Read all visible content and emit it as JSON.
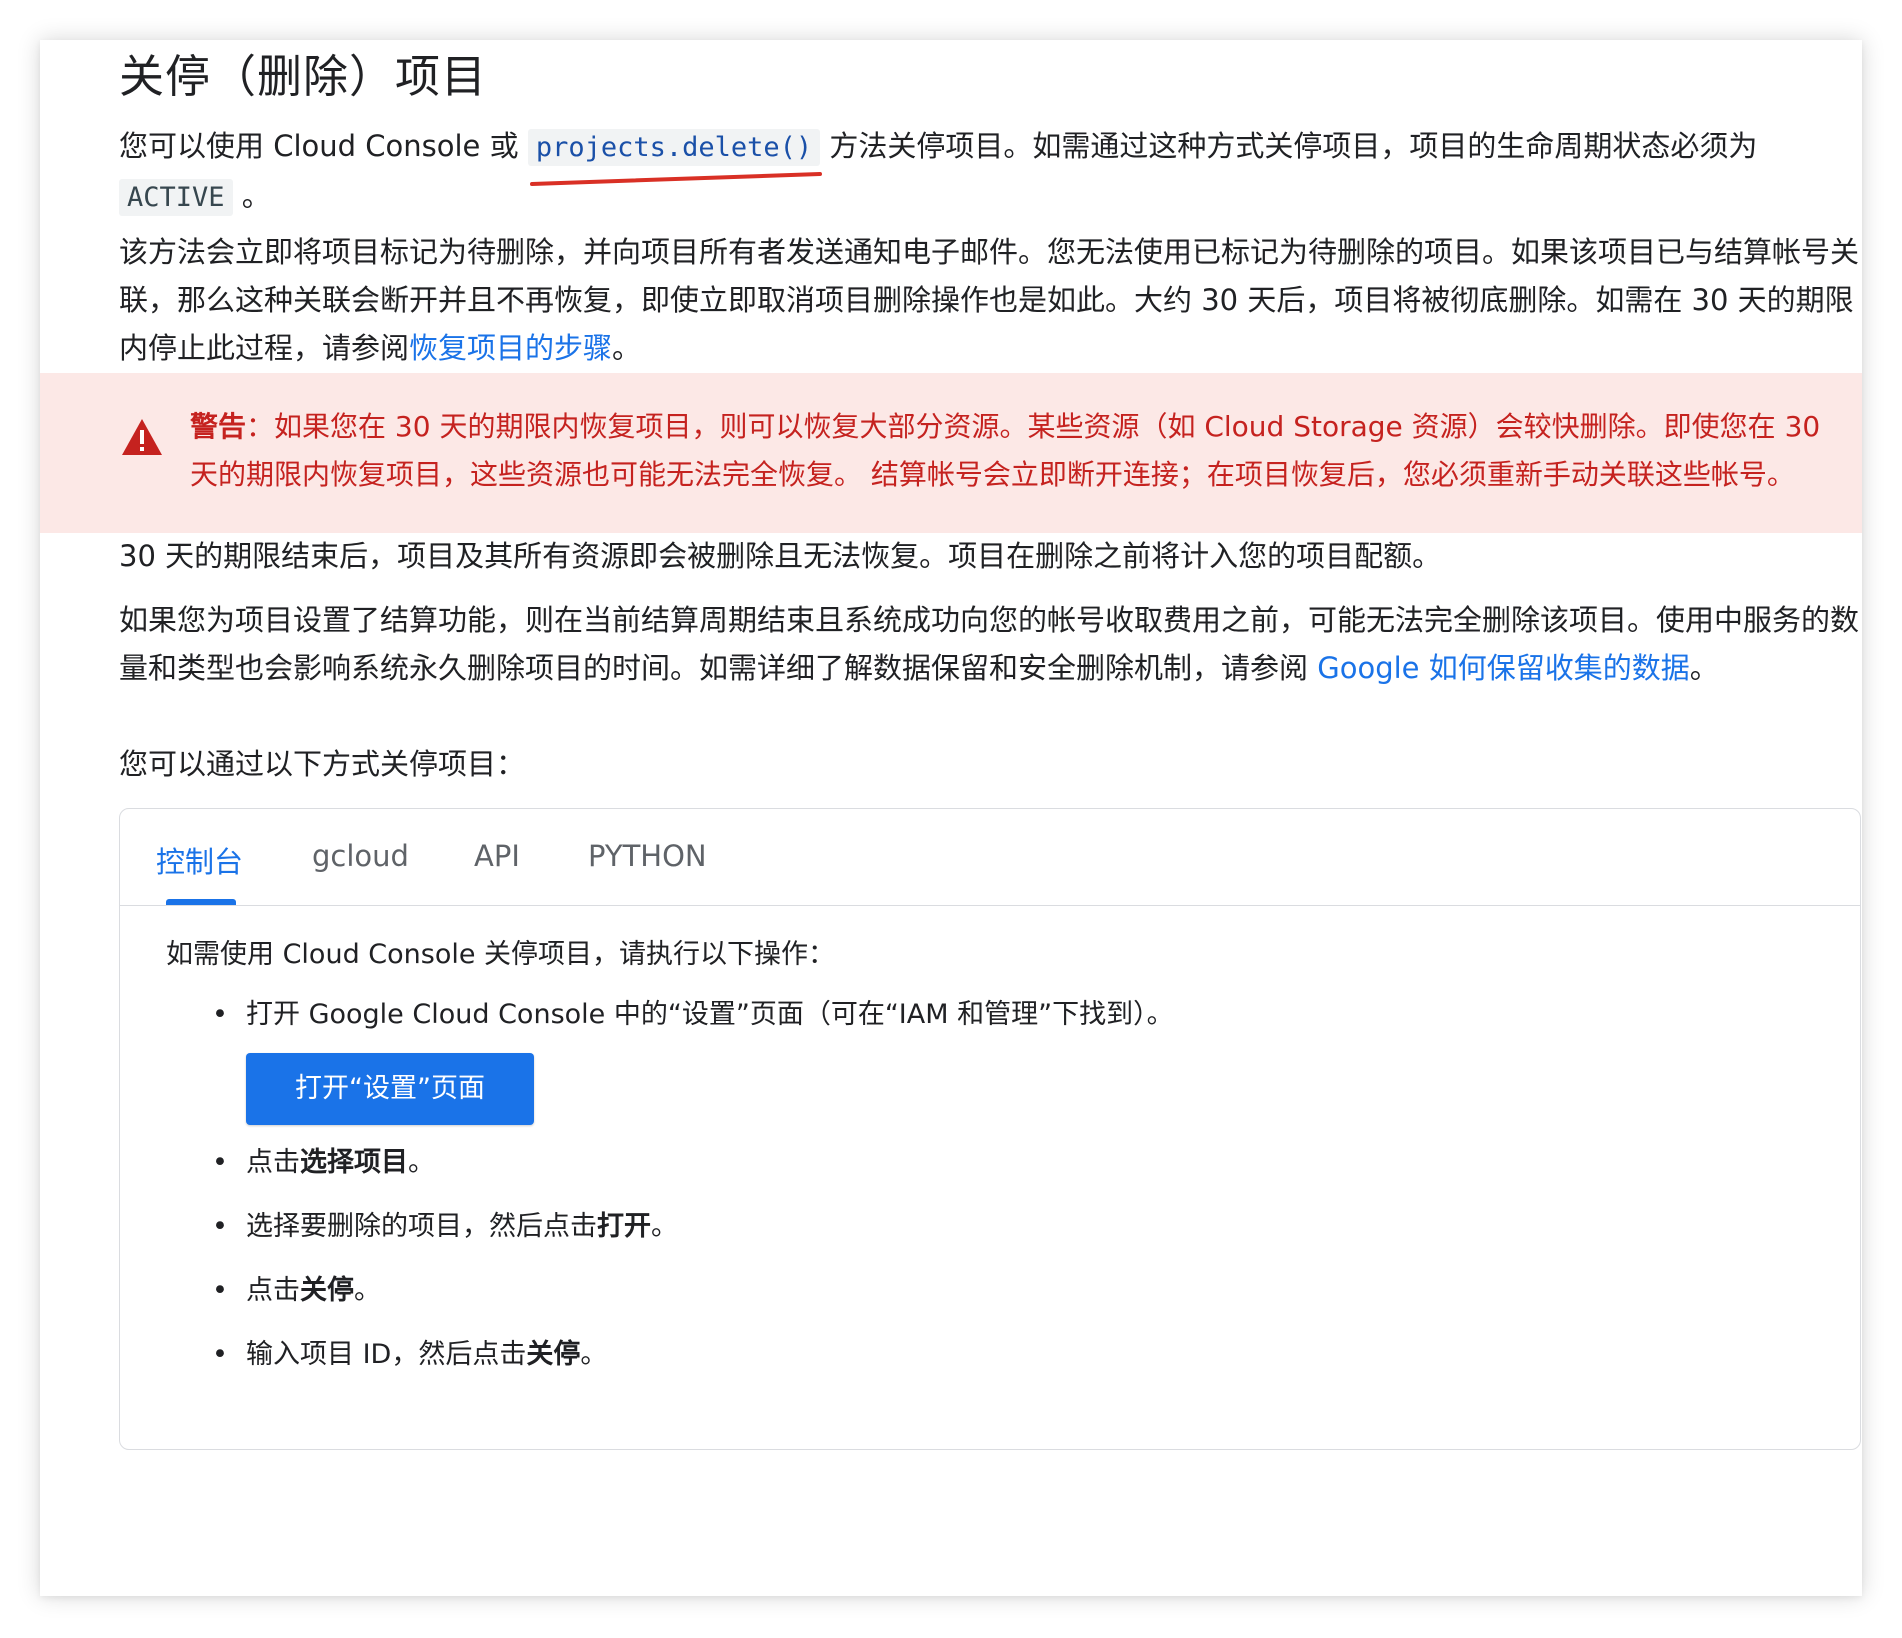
{
  "page": {
    "title": "关停（删除）项目"
  },
  "intro": {
    "part1": "您可以使用 Cloud Console 或 ",
    "code_link": "projects.delete()",
    "part2": " 方法关停项目。如需通过这种方式关停项目，项目的生命周期状态必须为 ",
    "state_code": "ACTIVE",
    "part3": " 。"
  },
  "para2": {
    "text": "该方法会立即将项目标记为待删除，并向项目所有者发送通知电子邮件。您无法使用已标记为待删除的项目。如果该项目已与结算帐号关联，那么这种关联会断开并且不再恢复，即使立即取消项目删除操作也是如此。大约 30 天后，项目将被彻底删除。如需在 30 天的期限内停止此过程，请参阅",
    "link": "恢复项目的步骤",
    "end": "。"
  },
  "warning": {
    "label": "警告",
    "text": "：如果您在 30 天的期限内恢复项目，则可以恢复大部分资源。某些资源（如 Cloud Storage 资源）会较快删除。即使您在 30 天的期限内恢复项目，这些资源也可能无法完全恢复。 结算帐号会立即断开连接；在项目恢复后，您必须重新手动关联这些帐号。",
    "color": "#c5221f",
    "background": "#fce8e6"
  },
  "para3": {
    "text": "30 天的期限结束后，项目及其所有资源即会被删除且无法恢复。项目在删除之前将计入您的项目配额。"
  },
  "para4": {
    "text": "如果您为项目设置了结算功能，则在当前结算周期结束且系统成功向您的帐号收取费用之前，可能无法完全删除该项目。使用中服务的数量和类型也会影响系统永久删除项目的时间。如需详细了解数据保留和安全删除机制，请参阅 ",
    "link": "Google 如何保留收集的数据",
    "end": "。"
  },
  "para5": {
    "text": "您可以通过以下方式关停项目："
  },
  "tabs": [
    {
      "label": "控制台",
      "active": true
    },
    {
      "label": "gcloud",
      "active": false
    },
    {
      "label": "API",
      "active": false
    },
    {
      "label": "PYTHON",
      "active": false
    }
  ],
  "panel": {
    "intro": "如需使用 Cloud Console 关停项目，请执行以下操作：",
    "step1": "打开 Google Cloud Console 中的“设置”页面（可在“IAM 和管理”下找到）。",
    "button_label": "打开“设置”页面",
    "step2_pre": "点击",
    "step2_bold": "选择项目",
    "step2_end": "。",
    "step3_pre": "选择要删除的项目，然后点击",
    "step3_bold": "打开",
    "step3_end": "。",
    "step4_pre": "点击",
    "step4_bold": "关停",
    "step4_end": "。",
    "step5_pre": "输入项目 ID，然后点击",
    "step5_bold": "关停",
    "step5_end": "。"
  },
  "colors": {
    "accent": "#1a73e8",
    "annotation_underline": "#d93025"
  }
}
